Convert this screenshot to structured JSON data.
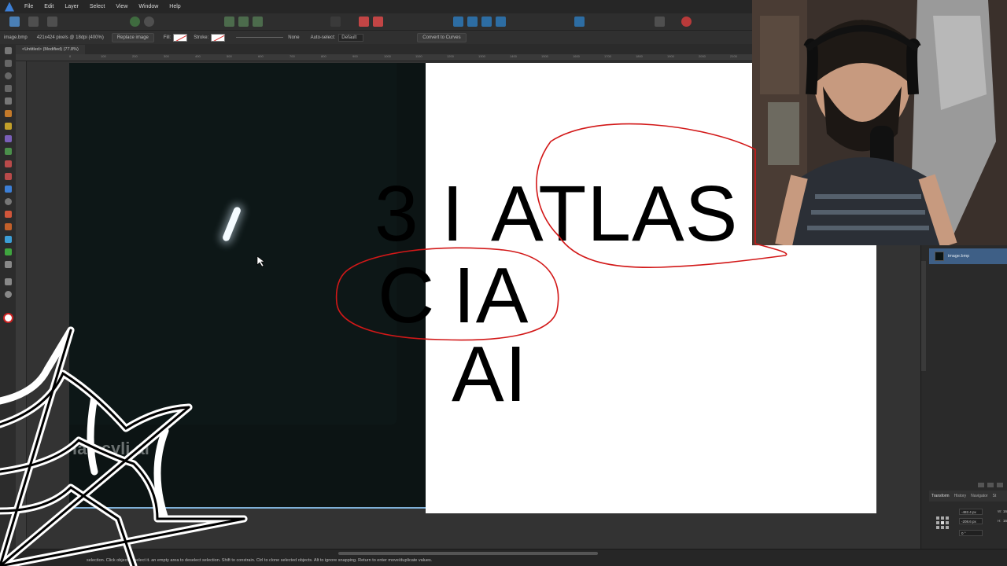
{
  "menu": [
    "File",
    "Edit",
    "Layer",
    "Select",
    "View",
    "Window",
    "Help"
  ],
  "context_bar": {
    "file": "image.bmp",
    "dims": "421x424 pixels @ 18dpi (400%)",
    "replace_image": "Replace image",
    "fill_label": "Fill:",
    "stroke_label": "Stroke:",
    "stroke_value": "None",
    "autoselect_label": "Auto-select:",
    "autoselect_value": "Default",
    "convert_label": "Convert to Curves"
  },
  "doc_tab": "<Untitled> (Modified) (77.8%)",
  "ruler_labels": [
    "0",
    "100",
    "200",
    "300",
    "400",
    "500",
    "600",
    "700",
    "800",
    "900",
    "1000",
    "1100",
    "1200",
    "1300",
    "1400",
    "1500",
    "1600",
    "1700",
    "1800",
    "1900",
    "2000",
    "2100"
  ],
  "canvas": {
    "dark_caption": "las cyli      al",
    "line1a": "3 I",
    "line1b": "ATLAS",
    "line2a": "C",
    "line2b": "IA",
    "line3": "AI"
  },
  "layers_panel": {
    "layer_name": "image.bmp"
  },
  "panel_tabs": [
    "Transform",
    "History",
    "Navigator",
    "St"
  ],
  "transform": {
    "x": "-482.4 px",
    "y": "-208.6 px",
    "r": "0 °",
    "w_label": "W:",
    "h_label": "H:",
    "w_value": "16",
    "h_value": "16"
  },
  "status": "selection. Click      object to select it.      an empty area to deselect selection. Shift to constrain. Ctrl to clone selected objects. Alt to ignore snapping. Return to enter move/duplicate values.",
  "colors": {
    "annotation_red": "#d21818",
    "dark_image": "#0c1414",
    "selection_blue": "#3e5f86"
  }
}
